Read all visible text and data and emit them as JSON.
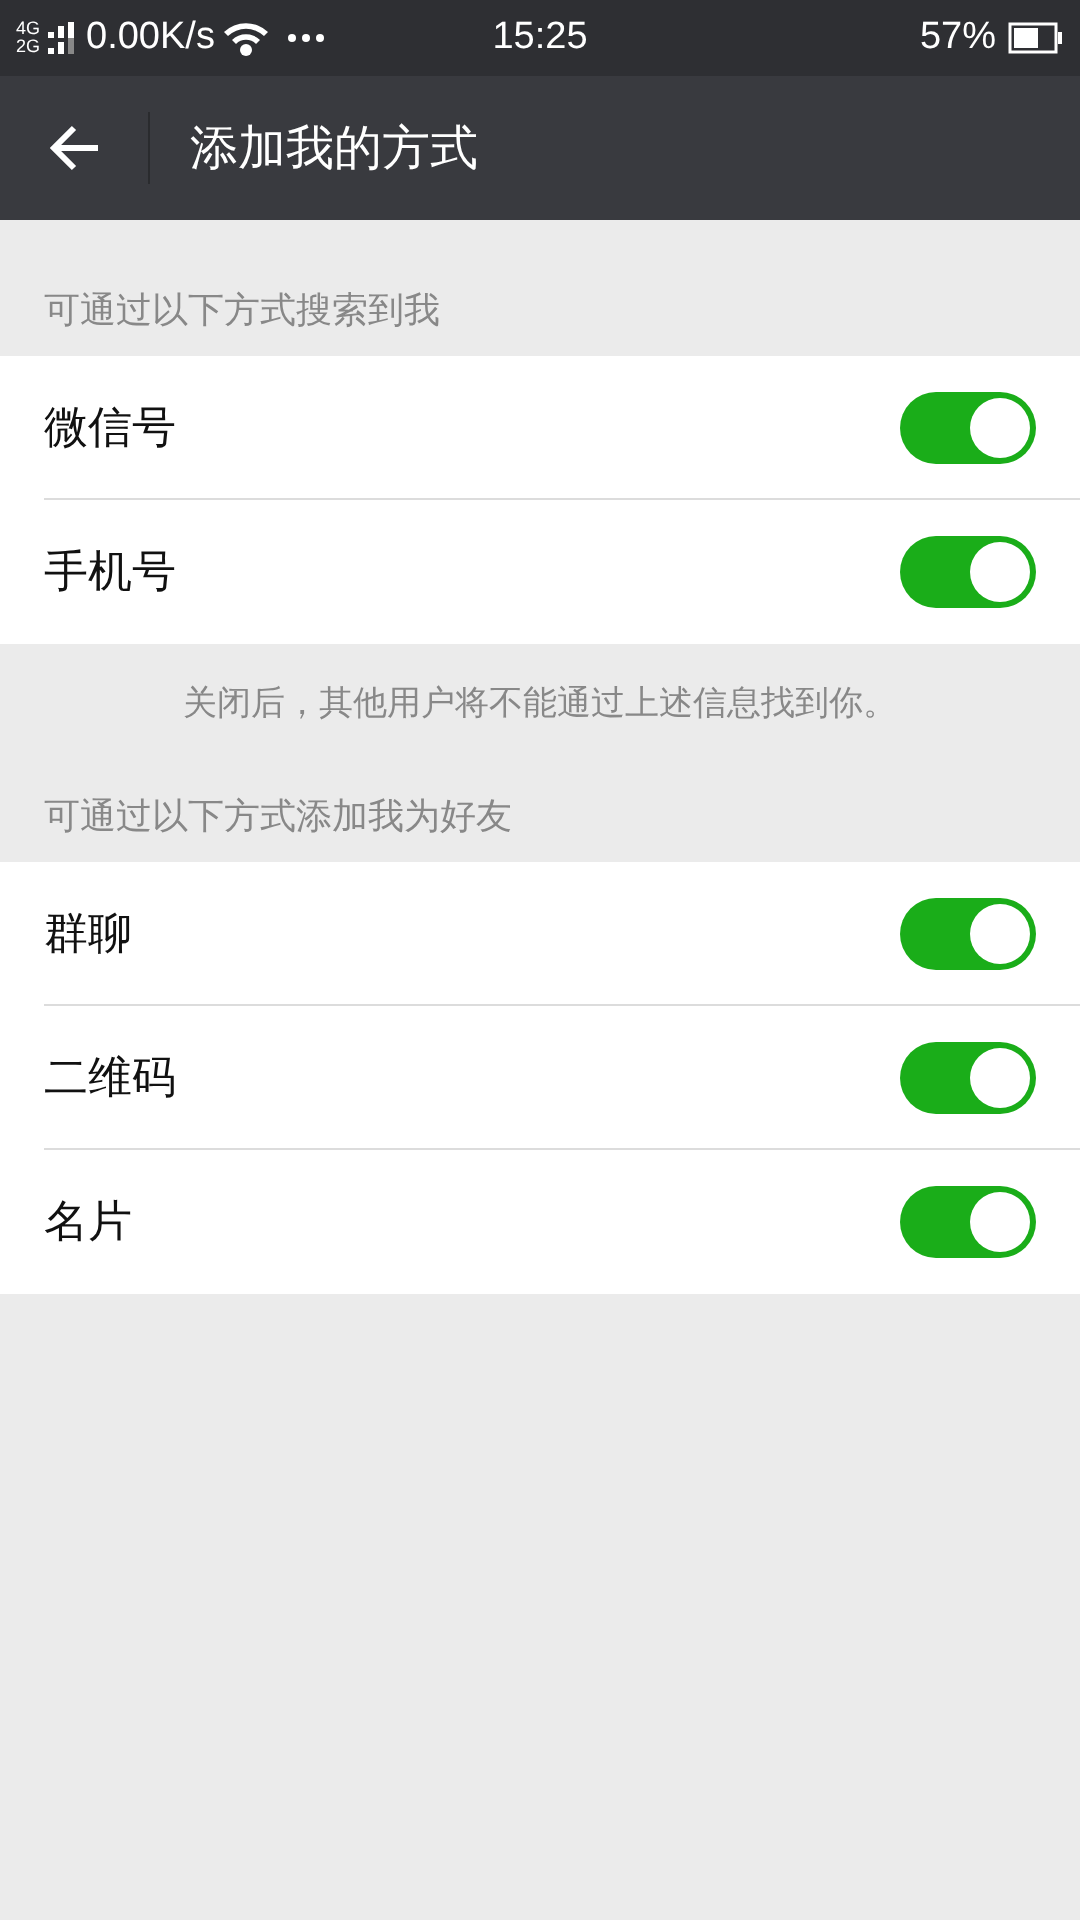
{
  "status_bar": {
    "network_labels": [
      "4G",
      "2G"
    ],
    "speed": "0.00K/s",
    "time": "15:25",
    "battery": "57%"
  },
  "header": {
    "title": "添加我的方式"
  },
  "sections": [
    {
      "heading": "可通过以下方式搜索到我",
      "items": [
        {
          "label": "微信号",
          "on": true
        },
        {
          "label": "手机号",
          "on": true
        }
      ],
      "note": "关闭后，其他用户将不能通过上述信息找到你。"
    },
    {
      "heading": "可通过以下方式添加我为好友",
      "items": [
        {
          "label": "群聊",
          "on": true
        },
        {
          "label": "二维码",
          "on": true
        },
        {
          "label": "名片",
          "on": true
        }
      ]
    }
  ]
}
